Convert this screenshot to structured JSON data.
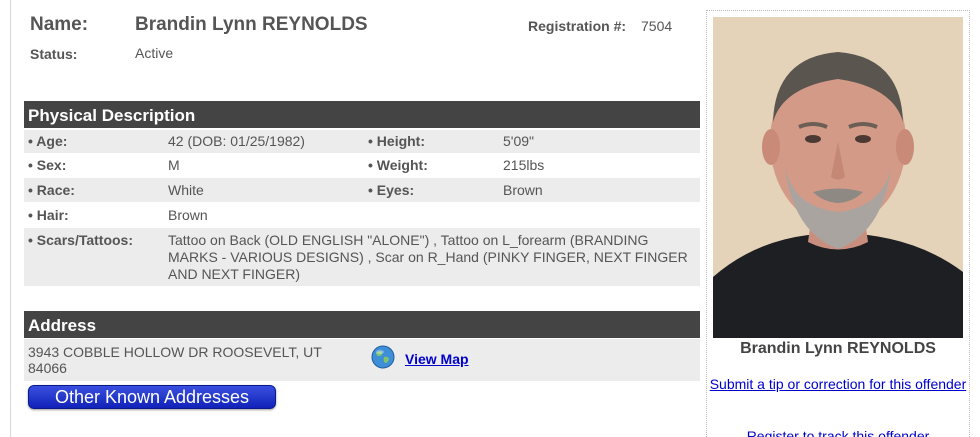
{
  "header": {
    "name_label": "Name:",
    "name_value": "Brandin Lynn REYNOLDS",
    "registration_label": "Registration #:",
    "registration_value": "7504",
    "status_label": "Status:",
    "status_value": "Active"
  },
  "physical": {
    "title": "Physical Description",
    "age_label": "Age:",
    "age_value": "42  (DOB: 01/25/1982)",
    "height_label": "Height:",
    "height_value": "5'09\"",
    "sex_label": "Sex:",
    "sex_value": "M",
    "weight_label": "Weight:",
    "weight_value": "215lbs",
    "race_label": "Race:",
    "race_value": "White",
    "eyes_label": "Eyes:",
    "eyes_value": "Brown",
    "hair_label": "Hair:",
    "hair_value": "Brown",
    "scars_label": "Scars/Tattoos:",
    "scars_value": "Tattoo on Back (OLD ENGLISH \"ALONE\") , Tattoo on L_forearm (BRANDING MARKS - VARIOUS DESIGNS) , Scar on R_Hand (PINKY FINGER, NEXT FINGER AND NEXT FINGER)"
  },
  "address": {
    "title": "Address",
    "line": "3943 COBBLE HOLLOW DR ROOSEVELT, UT 84066",
    "map_link": "View Map",
    "map_icon": "globe-icon",
    "other_button": "Other Known Addresses"
  },
  "sidebar": {
    "photo_caption": "Brandin Lynn REYNOLDS",
    "tip_link": "Submit a tip or correction for this offender",
    "register_link": "Register to track this offender"
  },
  "colors": {
    "section_header_bg": "#444444",
    "row_shade": "#ececec",
    "link": "#0000cc",
    "button": "#1a2fd0"
  }
}
